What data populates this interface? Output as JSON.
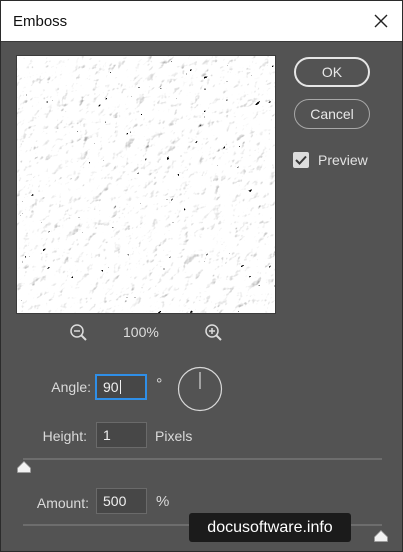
{
  "window": {
    "title": "Emboss"
  },
  "buttons": {
    "ok": "OK",
    "cancel": "Cancel"
  },
  "preview_toggle": {
    "label": "Preview",
    "checked": true
  },
  "zoom": {
    "level": "100%"
  },
  "angle": {
    "label": "Angle:",
    "value": "90",
    "unit": "°"
  },
  "height": {
    "label": "Height:",
    "value": "1",
    "unit": "Pixels"
  },
  "amount": {
    "label": "Amount:",
    "value": "500",
    "unit": "%"
  },
  "watermark": {
    "text": "docusoftware.info"
  },
  "colors": {
    "dialog_bg": "#535353",
    "title_bar": "#ffffff",
    "focus_ring": "#2f8fe8",
    "field_bg": "#474747"
  },
  "icons": {
    "close": "close-icon",
    "zoom_out": "zoom-out-icon",
    "zoom_in": "zoom-in-icon",
    "check": "check-icon",
    "angle_dial": "angle-dial-icon",
    "slider": "slider-thumb-icon"
  }
}
